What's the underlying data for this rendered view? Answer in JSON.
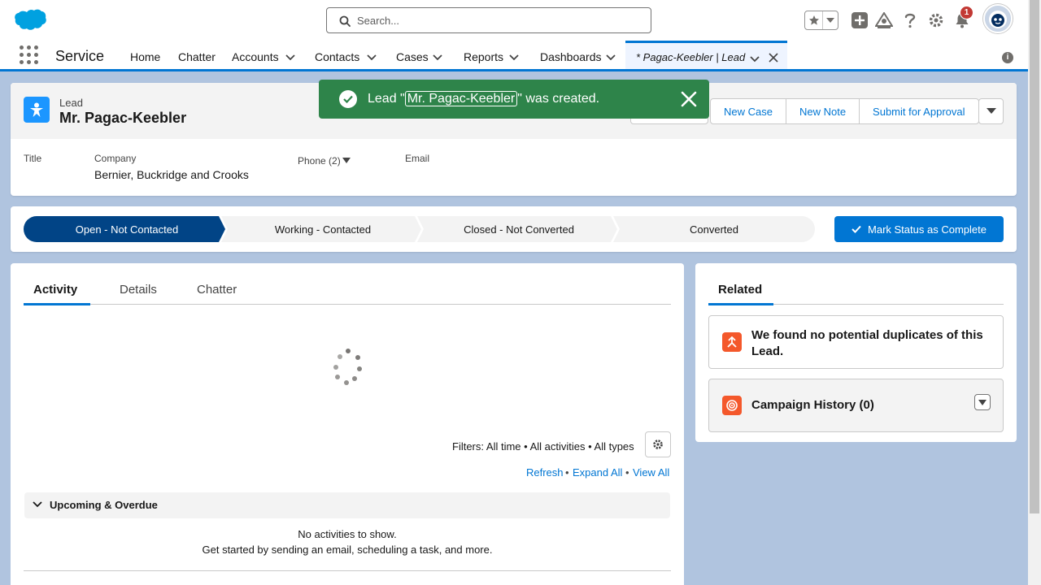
{
  "header": {
    "search_placeholder": "Search...",
    "notification_count": "1"
  },
  "nav": {
    "app_name": "Service",
    "items": [
      {
        "label": "Home"
      },
      {
        "label": "Chatter"
      },
      {
        "label": "Accounts"
      },
      {
        "label": "Contacts"
      },
      {
        "label": "Cases"
      },
      {
        "label": "Reports"
      },
      {
        "label": "Dashboards"
      }
    ],
    "active_tab": "* Pagac-Keebler | Lead",
    "info": "i"
  },
  "toast": {
    "prefix": "Lead \"",
    "link": "Mr. Pagac-Keebler",
    "suffix": "\" was created."
  },
  "record": {
    "object_label": "Lead",
    "name": "Mr. Pagac-Keebler",
    "actions": [
      "New Case",
      "New Note",
      "Submit for Approval"
    ],
    "fields": {
      "title_label": "Title",
      "company_label": "Company",
      "company_value": "Bernier, Buckridge and Crooks",
      "phone_label": "Phone (2)",
      "email_label": "Email"
    }
  },
  "path": {
    "stages": [
      "Open - Not Contacted",
      "Working - Contacted",
      "Closed - Not Converted",
      "Converted"
    ],
    "current_stage": 0,
    "mark_button": "Mark Status as Complete"
  },
  "activity": {
    "tabs": [
      "Activity",
      "Details",
      "Chatter"
    ],
    "active_tab": 0,
    "filters": "Filters: All time • All activities • All types",
    "links": [
      "Refresh",
      "Expand All",
      "View All"
    ],
    "upcoming_label": "Upcoming & Overdue",
    "empty_title": "No activities to show.",
    "empty_subtitle": "Get started by sending an email, scheduling a task, and more."
  },
  "related": {
    "tab": "Related",
    "duplicates_text": "We found no potential duplicates of this Lead.",
    "campaign_history": "Campaign History (0)"
  },
  "colors": {
    "brand_blue": "#0176d3",
    "toast_green": "#2e844a",
    "path_active": "#014486",
    "lead_icon": "#1b96ff",
    "related_icon": "#f4582b"
  }
}
